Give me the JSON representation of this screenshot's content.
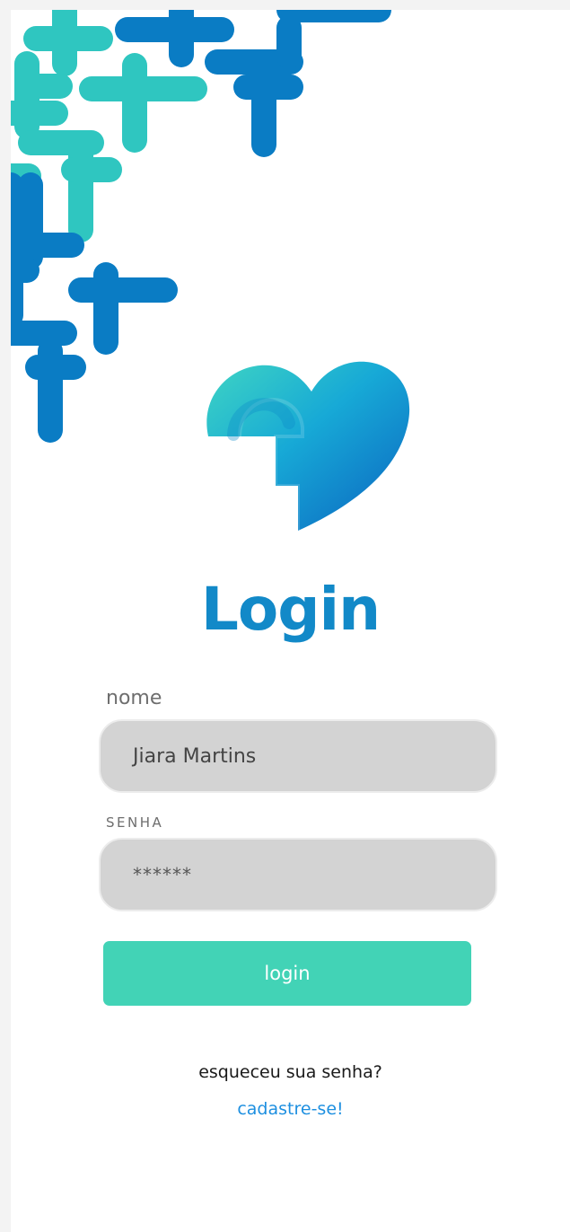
{
  "header": {
    "pattern_icon": "medical-cross-pattern-icon",
    "logo_icon": "heart-cross-logo-icon"
  },
  "login": {
    "title": "Login",
    "name_label": "nome",
    "name_value": "Jiara Martins",
    "password_label": "SENHA",
    "password_value": "******",
    "submit_label": "login",
    "forgot_link": "esqueceu sua senha?",
    "signup_link": "cadastre-se!"
  },
  "colors": {
    "brand_blue": "#1289c8",
    "teal": "#42d3b6",
    "link_blue": "#1d8fe0",
    "field_bg": "#d3d3d3"
  }
}
